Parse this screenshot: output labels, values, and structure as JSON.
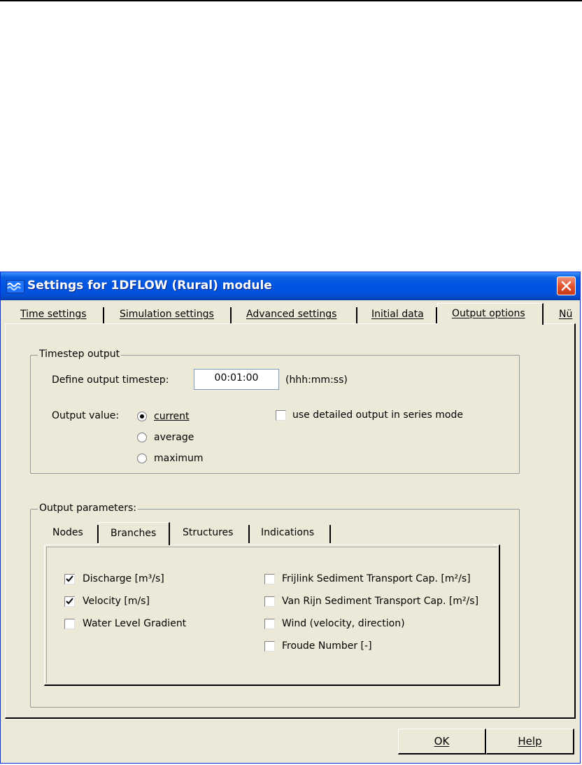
{
  "window": {
    "title": "Settings for 1DFLOW (Rural) module",
    "icon": "water-waves-icon",
    "accent": "#0054e3",
    "face_color": "#ece9d8"
  },
  "tabs": [
    {
      "label": "Time settings",
      "active": false
    },
    {
      "label": "Simulation settings",
      "active": false
    },
    {
      "label": "Advanced settings",
      "active": false
    },
    {
      "label": "Initial data",
      "active": false
    },
    {
      "label": "Output options",
      "active": true
    },
    {
      "label": "Nü",
      "active": false
    }
  ],
  "timestep_output": {
    "legend": "Timestep output",
    "define_label": "Define output timestep:",
    "timestep_value": "00:01:00",
    "format_hint": "(hhh:mm:ss)",
    "output_value_label": "Output value:",
    "options": [
      {
        "label": "current",
        "selected": true
      },
      {
        "label": "average",
        "selected": false
      },
      {
        "label": "maximum",
        "selected": false
      }
    ],
    "detailed_output": {
      "label": "use detailed output in series mode",
      "checked": false
    }
  },
  "output_parameters": {
    "legend": "Output parameters:",
    "subtabs": [
      {
        "label": "Nodes",
        "active": false
      },
      {
        "label": "Branches",
        "active": true
      },
      {
        "label": "Structures",
        "active": false
      },
      {
        "label": "Indications",
        "active": false
      }
    ],
    "left_options": [
      {
        "label": "Discharge [m³/s]",
        "checked": true
      },
      {
        "label": "Velocity [m/s]",
        "checked": true
      },
      {
        "label": "Water Level Gradient",
        "checked": false
      }
    ],
    "right_options": [
      {
        "label": "Frijlink Sediment Transport Cap. [m²/s]",
        "checked": false
      },
      {
        "label": "Van Rijn Sediment Transport Cap. [m²/s]",
        "checked": false
      },
      {
        "label": "Wind (velocity, direction)",
        "checked": false
      },
      {
        "label": "Froude Number [-]",
        "checked": false
      }
    ]
  },
  "buttons": {
    "ok": "OK",
    "help": "Help"
  }
}
